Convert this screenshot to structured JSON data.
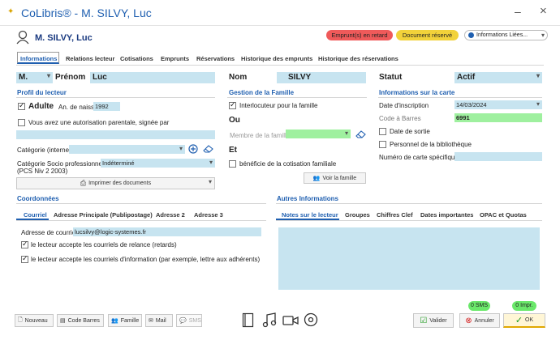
{
  "window": {
    "title": "CoLibris® - M. SILVY, Luc",
    "minimize": "–",
    "close": "×"
  },
  "header": {
    "name": "M. SILVY, Luc",
    "badge_late": "Emprunt(s) en retard",
    "badge_reserved": "Document réservé",
    "linked": "Informations Liées..."
  },
  "tabs": [
    "Informations",
    "Relations lecteur",
    "Cotisations",
    "Emprunts",
    "Réservations",
    "Historique des emprunts",
    "Historique des réservations"
  ],
  "identity": {
    "civility": "M.",
    "prenom_label": "Prénom",
    "prenom": "Luc",
    "nom_label": "Nom",
    "nom": "SILVY",
    "statut_label": "Statut",
    "statut": "Actif"
  },
  "profile": {
    "title": "Profil du lecteur",
    "adult": "Adulte",
    "birth_label": "An. de naiss.",
    "birth": "1992",
    "parental": "Vous avez une autorisation parentale, signée par",
    "category_label": "Catégorie (interne)",
    "socio_label": "Catégorie Socio professionnelle",
    "socio_sub": "(PCS Niv 2 2003)",
    "socio_value": "Indéterminé",
    "print": "Imprimer des documents"
  },
  "family": {
    "title": "Gestion de la Famille",
    "interlocutor": "Interlocuteur pour la famille",
    "ou": "Ou",
    "member_placeholder": "Membre de la famille",
    "et": "Et",
    "benefit": "bénéficie de la cotisation familiale",
    "see": "Voir la famille"
  },
  "card": {
    "title": "Informations sur la carte",
    "date_label": "Date d'inscription",
    "date": "14/03/2024",
    "barcode_label": "Code à Barres",
    "barcode": "6991",
    "exit_label": "Date de sortie",
    "staff": "Personnel de la bibliothèque",
    "specific_label": "Numéro de carte spécifique"
  },
  "contacts": {
    "title": "Coordonnées",
    "tabs": [
      "Courriel",
      "Adresse Principale (Publipostage)",
      "Adresse 2",
      "Adresse 3"
    ],
    "email_label": "Adresse de courriel",
    "email": "lucsilvy@logic-systemes.fr",
    "reminders": "le lecteur accepte les courriels de relance (retards)",
    "info": "le lecteur accepte les courriels d'information (par exemple, lettre aux adhérents)"
  },
  "other": {
    "title": "Autres Informations",
    "tabs": [
      "Notes sur le lecteur",
      "Groupes",
      "Chiffres Clef",
      "Dates importantes",
      "OPAC et Quotas"
    ]
  },
  "footer": {
    "new": "Nouveau",
    "barcode": "Code Barres",
    "family": "Famille",
    "mail": "Mail",
    "sms": "SMS",
    "sms_count": "0 SMS",
    "print_count": "0 Impr.",
    "validate": "Valider",
    "cancel": "Annuler",
    "ok": "OK"
  },
  "colors": {
    "accent": "#1f5fb0",
    "field": "#c7e4f0",
    "green": "#9ff09f",
    "late": "#ef5a5a",
    "reserved": "#f2d23a"
  }
}
